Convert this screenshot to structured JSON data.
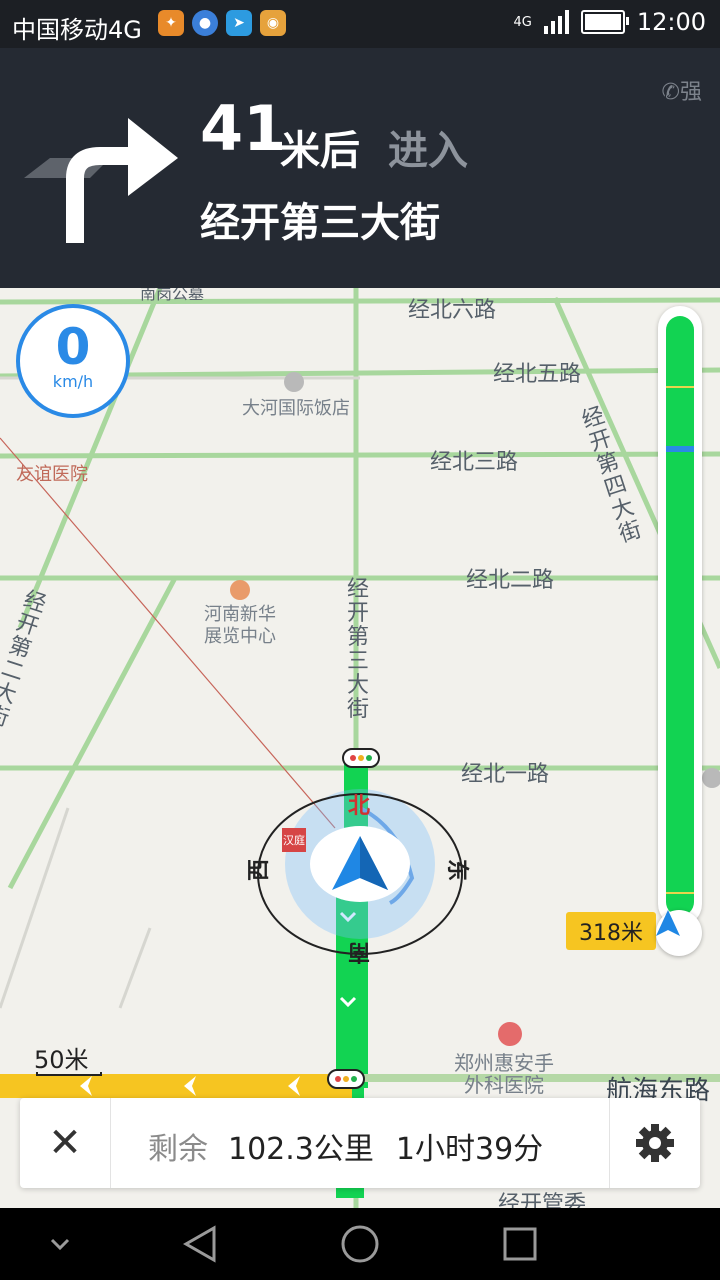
{
  "status_bar": {
    "carrier": "中国移动4G",
    "network": "4G",
    "time": "12:00"
  },
  "banner": {
    "distance_value": "41",
    "distance_unit": "米后",
    "action": "进入",
    "road_name": "经开第三大街",
    "gps_signal": "强"
  },
  "map": {
    "speed_value": "0",
    "speed_unit": "km/h",
    "road_labels": {
      "jingbei6": "经北六路",
      "jingbei5": "经北五路",
      "jingbei3": "经北三路",
      "jingbei2": "经北二路",
      "jingbei1": "经北一路",
      "hanghai": "航海东路",
      "jingkai4": "经开第四大街",
      "jingkai3": "经开第三大街",
      "jingkai2": "经开第二大街",
      "nanguan": "南岗公墓",
      "jingkai_guanwei": "经开管委"
    },
    "pois": {
      "hotel": "大河国际饭店",
      "hospital_left": "友谊医院",
      "exhibition_line1": "河南新华",
      "exhibition_line2": "展览中心",
      "hospital_line1": "郑州惠安手",
      "hospital_line2": "外科医院",
      "badge": "汉庭"
    },
    "compass": {
      "north": "北",
      "south": "南",
      "east": "东",
      "west": "西"
    },
    "remaining_to_turn": "318米",
    "scale_label": "50米",
    "route_colors": {
      "green": "#12d352",
      "yellow": "#f6c521",
      "blue": "#2a8ae6"
    }
  },
  "bottom_bar": {
    "remain_label": "剩余",
    "remain_distance": "102.3公里",
    "remain_time": "1小时39分"
  }
}
